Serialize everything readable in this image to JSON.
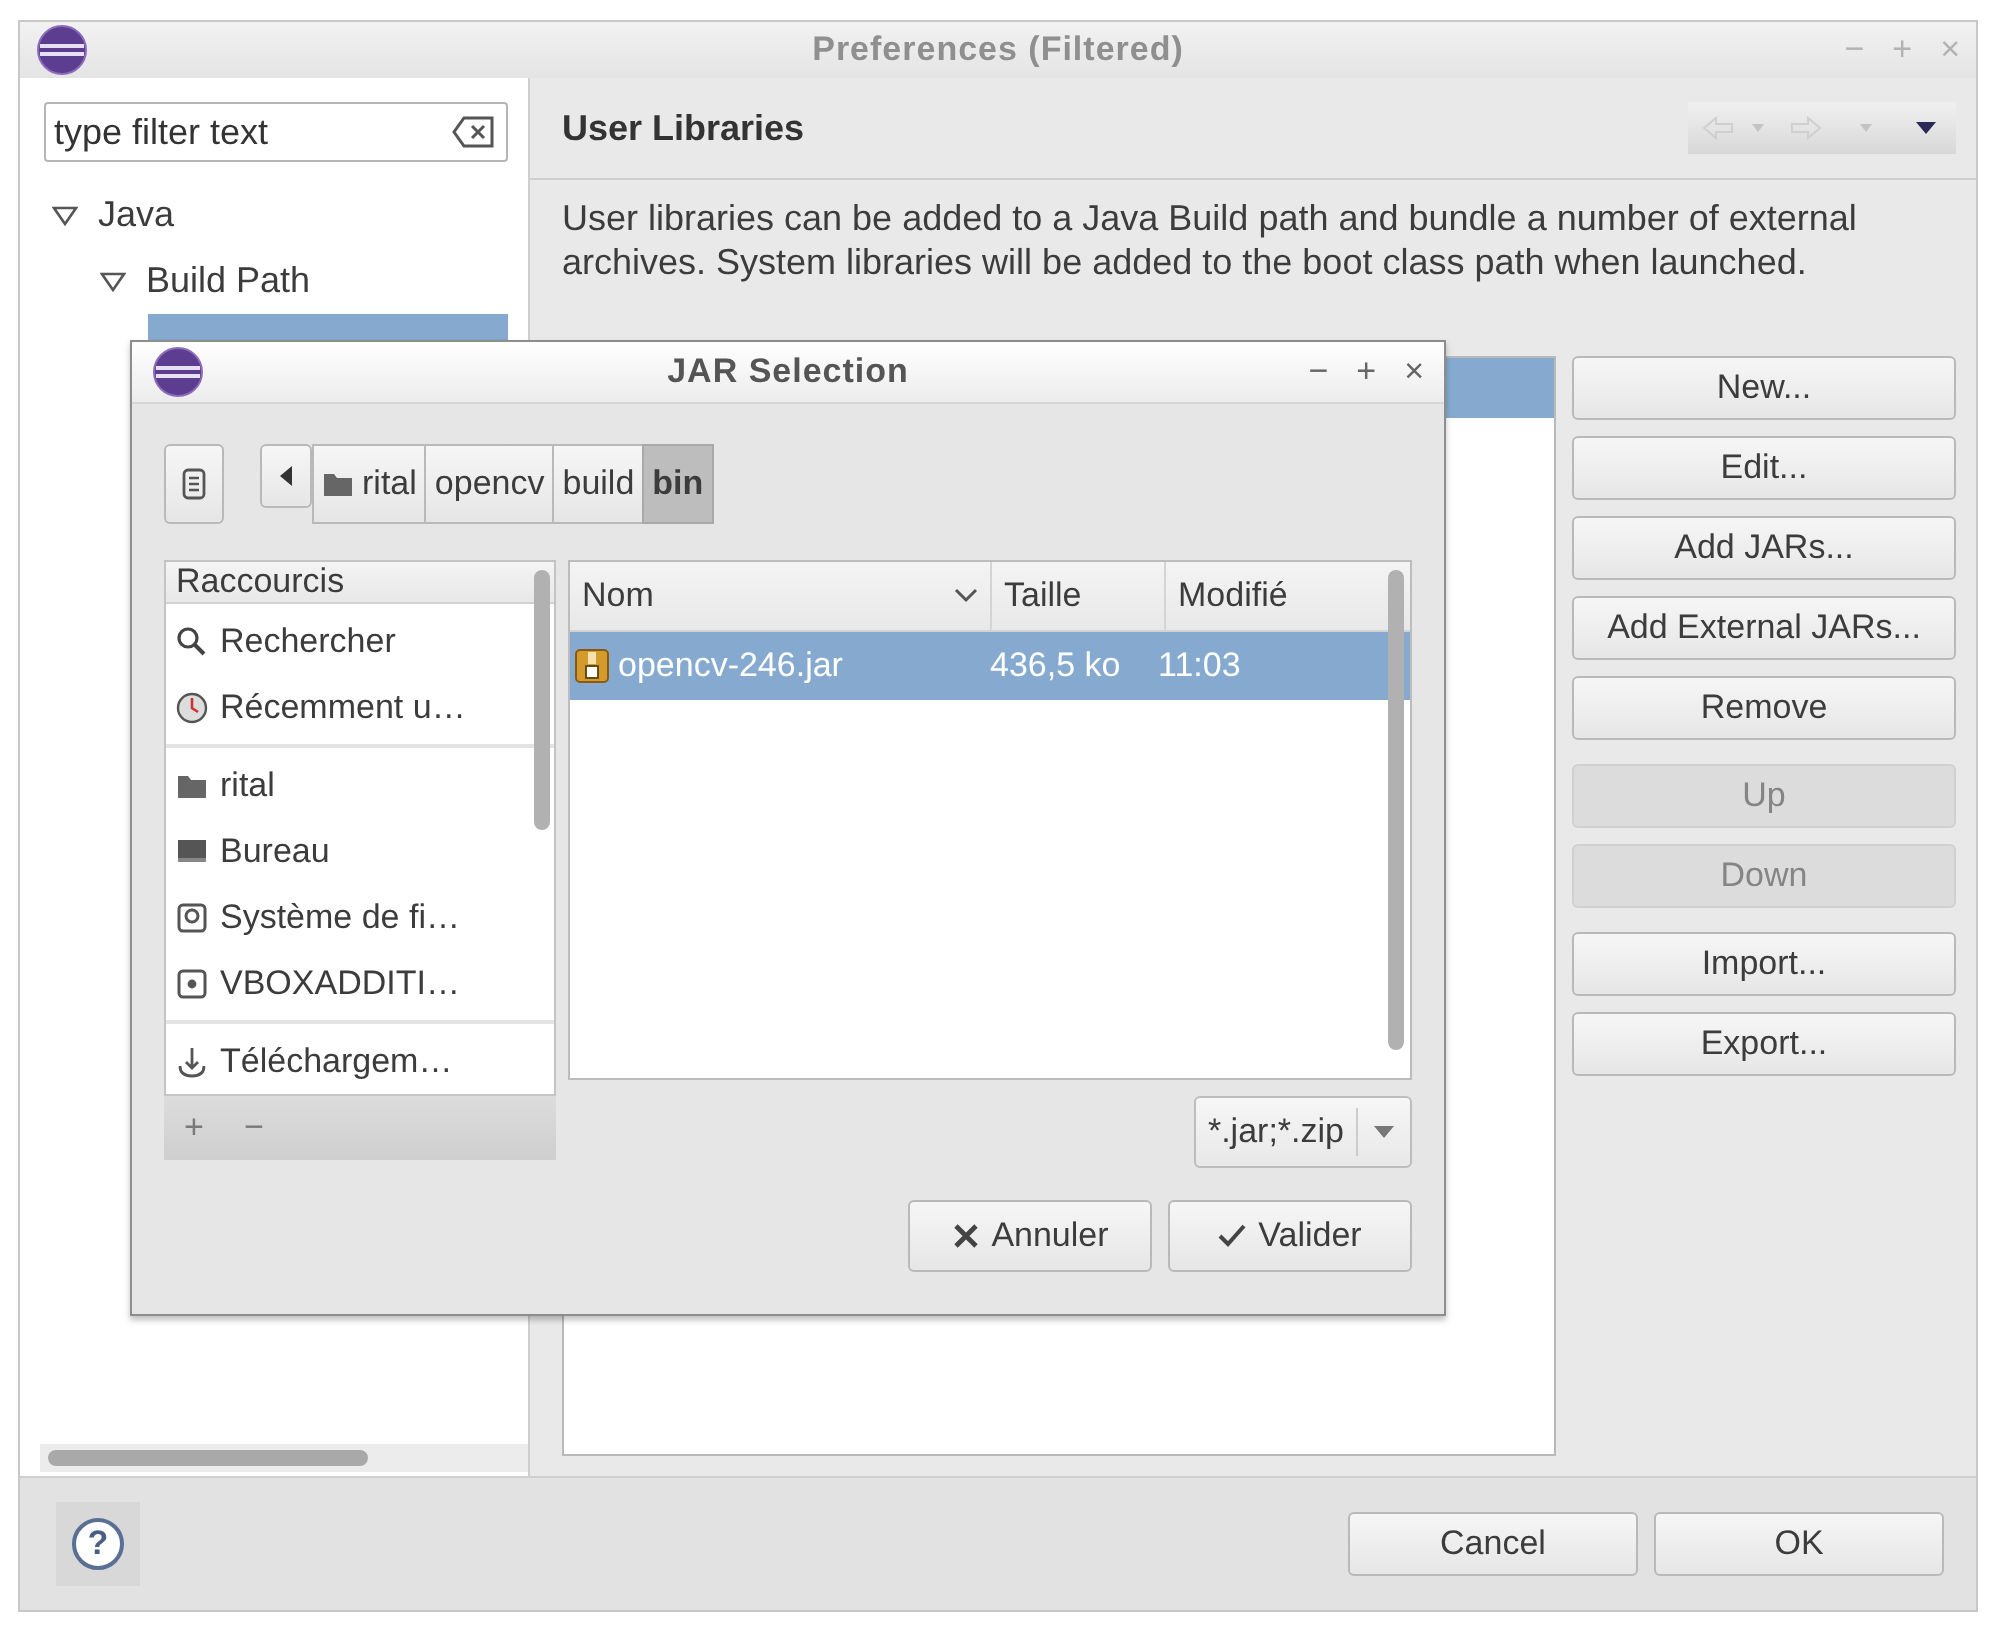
{
  "preferences_window": {
    "title": "Preferences (Filtered)",
    "window_controls": [
      "−",
      "+",
      "×"
    ]
  },
  "filter": {
    "placeholder": "type filter text"
  },
  "tree": [
    {
      "label": "Java",
      "expanded": true,
      "children": [
        {
          "label": "Build Path",
          "expanded": true,
          "children": [
            {
              "selected": true
            }
          ]
        }
      ]
    }
  ],
  "page": {
    "title": "User Libraries",
    "description": "User libraries can be added to a Java Build path and bundle a number of external archives. System libraries will be added to the boot class path when launched."
  },
  "libraries": [
    {
      "selected": true
    }
  ],
  "button_groups": [
    [
      {
        "label": "New...",
        "disabled": false
      },
      {
        "label": "Edit...",
        "disabled": false
      },
      {
        "label": "Add JARs...",
        "disabled": false
      },
      {
        "label": "Add External JARs...",
        "disabled": false
      },
      {
        "label": "Remove",
        "disabled": false
      }
    ],
    [
      {
        "label": "Up",
        "disabled": true
      },
      {
        "label": "Down",
        "disabled": true
      }
    ],
    [
      {
        "label": "Import...",
        "disabled": false
      },
      {
        "label": "Export...",
        "disabled": false
      }
    ]
  ],
  "help_button": "?",
  "dialog_buttons": [
    "Cancel",
    "OK"
  ],
  "jar_dialog": {
    "title": "JAR Selection",
    "window_controls": [
      "−",
      "+",
      "×"
    ],
    "path": [
      {
        "label": "rital",
        "kind": "folder",
        "selected": false
      },
      {
        "label": "opencv",
        "kind": "plain",
        "selected": false
      },
      {
        "label": "build",
        "kind": "plain",
        "selected": false
      },
      {
        "label": "bin",
        "kind": "plain",
        "selected": true
      }
    ],
    "places_header": "Raccourcis",
    "place_groups": [
      [
        {
          "label": "Rechercher",
          "kind": "search"
        },
        {
          "label": "Récemment u…",
          "kind": "recent"
        }
      ],
      [
        {
          "label": "rital",
          "kind": "folder"
        },
        {
          "label": "Bureau",
          "kind": "desktop"
        },
        {
          "label": "Système de fi…",
          "kind": "drive"
        },
        {
          "label": "VBOXADDITI…",
          "kind": "disc"
        }
      ],
      [
        {
          "label": "Téléchargem…",
          "kind": "download"
        }
      ]
    ],
    "place_actions": [
      "+",
      "−"
    ],
    "columns": [
      {
        "label": "Nom",
        "sorted": true
      },
      {
        "label": "Taille",
        "sorted": false
      },
      {
        "label": "Modifié",
        "sorted": false
      }
    ],
    "files": [
      {
        "name": "opencv-246.jar",
        "size": "436,5 ko",
        "modified": "11:03",
        "selected": true
      }
    ],
    "file_filter": "*.jar;*.zip",
    "buttons": [
      {
        "label": "Annuler",
        "kind": "cancel"
      },
      {
        "label": "Valider",
        "kind": "ok"
      }
    ]
  }
}
